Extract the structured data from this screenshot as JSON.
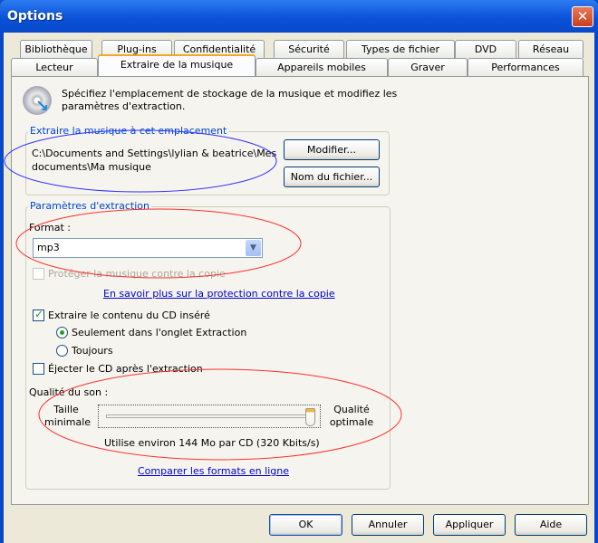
{
  "window": {
    "title": "Options"
  },
  "tabs_row1": [
    "Bibliothèque",
    "Plug-ins",
    "Confidentialité",
    "Sécurité",
    "Types de fichier",
    "DVD",
    "Réseau"
  ],
  "tabs_row2": [
    "Lecteur",
    "Extraire de la musique",
    "Appareils mobiles",
    "Graver",
    "Performances"
  ],
  "active_tab": "Extraire de la musique",
  "intro": {
    "line1": "Spécifiez l'emplacement de stockage de la musique et modifiez les",
    "line2": "paramètres d'extraction."
  },
  "location": {
    "group_label": "Extraire la musique à cet emplacement",
    "path_line1": "C:\\Documents and Settings\\lylian & beatrice\\Mes",
    "path_line2": "documents\\Ma musique",
    "modify_button": "Modifier...",
    "filename_button": "Nom du fichier..."
  },
  "settings": {
    "group_label": "Paramètres d'extraction",
    "format_label": "Format :",
    "format_value": "mp3",
    "protect_label": "Protéger la musique contre la copie",
    "protect_checked": false,
    "protect_link": "En savoir plus sur la protection contre la copie",
    "rip_cd_label": "Extraire le contenu du CD inséré",
    "rip_cd_checked": true,
    "radio_only_tab": "Seulement dans l'onglet Extraction",
    "radio_always": "Toujours",
    "radio_selected": "Seulement dans l'onglet Extraction",
    "eject_label": "Éjecter le CD après l'extraction",
    "eject_checked": false,
    "quality_label": "Qualité du son :",
    "min_label_1": "Taille",
    "min_label_2": "minimale",
    "max_label_1": "Qualité",
    "max_label_2": "optimale",
    "quality_level": 1.0,
    "usage_text": "Utilise environ 144 Mo par CD (320 Kbits/s)",
    "compare_link": "Comparer les formats en ligne"
  },
  "buttons": {
    "ok": "OK",
    "cancel": "Annuler",
    "apply": "Appliquer",
    "help": "Aide"
  },
  "annotation_colors": {
    "blue": "#3030ff",
    "red": "#ff3030"
  }
}
